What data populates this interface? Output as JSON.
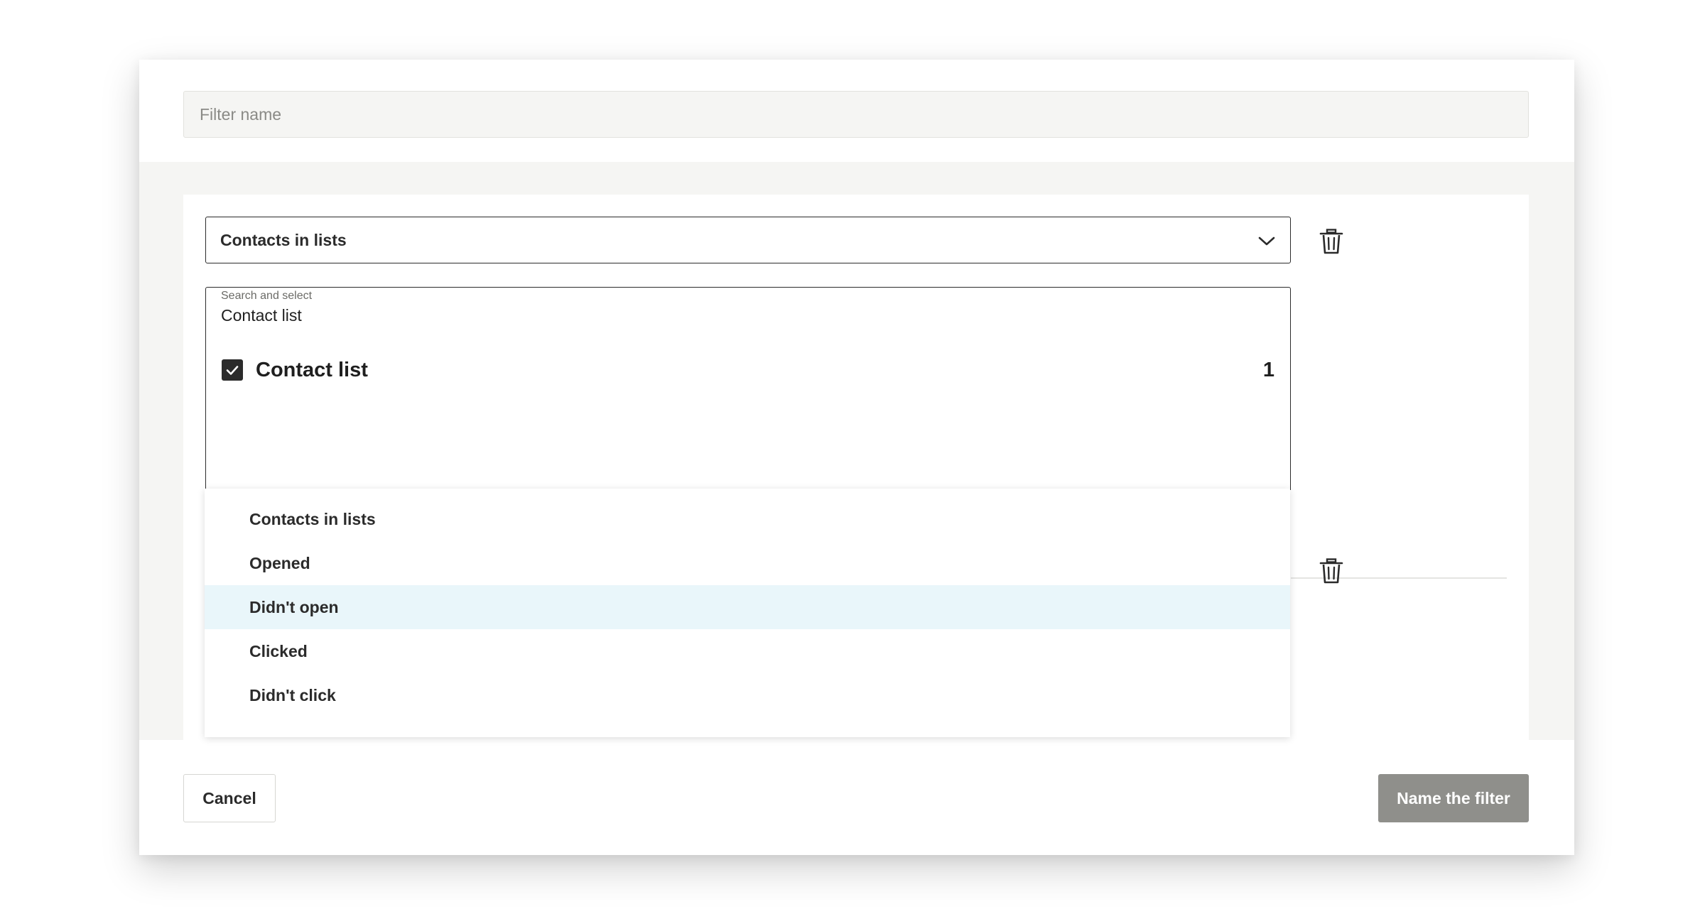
{
  "header": {
    "filter_name_placeholder": "Filter name",
    "filter_name_value": ""
  },
  "condition": {
    "selected_label": "Contacts in lists",
    "icon": "chevron-down-icon",
    "delete_icon": "trash-icon"
  },
  "search": {
    "label": "Search and select",
    "value": "Contact list"
  },
  "list": {
    "items": [
      {
        "name": "Contact list",
        "count": "1",
        "checked": true
      }
    ]
  },
  "second_condition": {
    "delete_icon": "trash-icon"
  },
  "dropdown": {
    "options": [
      {
        "label": "Contacts in lists",
        "highlighted": false
      },
      {
        "label": "Opened",
        "highlighted": false
      },
      {
        "label": "Didn't open",
        "highlighted": true
      },
      {
        "label": "Clicked",
        "highlighted": false
      },
      {
        "label": "Didn't click",
        "highlighted": false
      }
    ]
  },
  "footer": {
    "cancel_label": "Cancel",
    "submit_label": "Name the filter"
  },
  "colors": {
    "highlight": "#e9f6fa",
    "primary_disabled": "#8f8f8b",
    "panel_bg": "#f5f5f3",
    "border_dark": "#2b2b2b"
  }
}
